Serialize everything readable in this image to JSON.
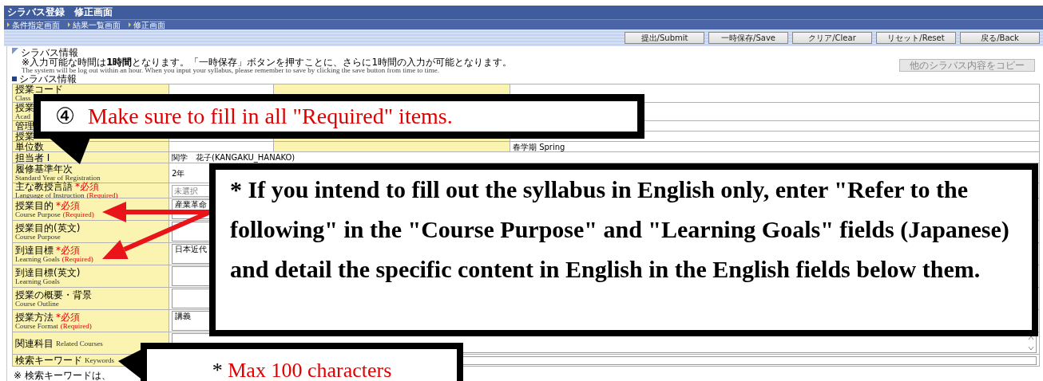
{
  "window": {
    "title": "シラバス登録　修正画面"
  },
  "breadcrumbs": [
    {
      "label": "条件指定画面"
    },
    {
      "label": "結果一覧画面"
    },
    {
      "label": "修正画面"
    }
  ],
  "toolbar": {
    "buttons": [
      "提出/Submit",
      "一時保存/Save",
      "クリア/Clear",
      "リセット/Reset",
      "戻る/Back"
    ]
  },
  "section": {
    "title": "シラバス情報",
    "notice_ja": "※入力可能な時間は**1時間**となります。「一時保存」ボタンを押すことに、さらに1時間の入力が可能となります。",
    "notice_en": "The system will be log out within an hour. When you input your syllabus, please remember to save by clicking the save button from time to time.",
    "copy_button": {
      "label": "他のシラバス内容をコピー",
      "disabled": true
    }
  },
  "form": {
    "title": "シラバス情報",
    "rows": [
      {
        "kind": "pair",
        "ja": "授業コード",
        "en": "Class"
      },
      {
        "kind": "pair",
        "ja": "授業",
        "en": "Acad"
      },
      {
        "kind": "pair",
        "ja": "管理"
      },
      {
        "kind": "pair",
        "ja": "授業"
      },
      {
        "kind": "pair",
        "ja": "単位数",
        "value_2": "春学期 Spring"
      },
      {
        "kind": "text",
        "ja": "担当者 I",
        "value": "関学　花子(KANGAKU_HANAKO)"
      },
      {
        "kind": "text",
        "ja": "履修基準年次",
        "en": "Standard Year of Registration",
        "value": "2年"
      },
      {
        "kind": "select",
        "ja": "主な教授言語",
        "ja_mark": "*必須",
        "en": "Language of Instruction",
        "en_mark": "(Required)",
        "value": "未選択"
      },
      {
        "kind": "textarea",
        "ja": "授業目的",
        "ja_mark": "*必須",
        "en": "Course Purpose",
        "en_mark": "(Required)",
        "value": "産業革命"
      },
      {
        "kind": "textarea",
        "ja": "授業目的(英文)",
        "en": "Course Purpose"
      },
      {
        "kind": "textarea",
        "ja": "到達目標",
        "ja_mark": "*必須",
        "en": "Learning Goals",
        "en_mark": "(Required)",
        "value": "日本近代"
      },
      {
        "kind": "textarea",
        "ja": "到達目標(英文)",
        "en": "Learning Goals"
      },
      {
        "kind": "textarea",
        "ja": "授業の概要・背景",
        "en": "Course Outline"
      },
      {
        "kind": "textarea",
        "ja": "授業方法",
        "ja_mark": "*必須",
        "en": "Course Format",
        "en_mark": "(Required)",
        "value": "講義"
      },
      {
        "kind": "scroll_textarea",
        "ja": "関連科目",
        "en": "Related Courses"
      },
      {
        "kind": "input",
        "ja": "検索キーワード",
        "en": "Keywords"
      }
    ]
  },
  "footnote": "※ 検索キーワードは、",
  "callouts": [
    {
      "kind": "top",
      "number": "④",
      "text": "Make sure to fill in all \"Required\" items."
    },
    {
      "kind": "note",
      "text": "* If you intend to fill out the syllabus in English only, enter \"Refer to the following\" in the \"Course Purpose\" and \"Learning Goals\" fields (Japanese) and detail the specific content in English in the English fields below them."
    },
    {
      "kind": "limit",
      "asterisk": "*",
      "text": "Max 100 characters"
    }
  ]
}
